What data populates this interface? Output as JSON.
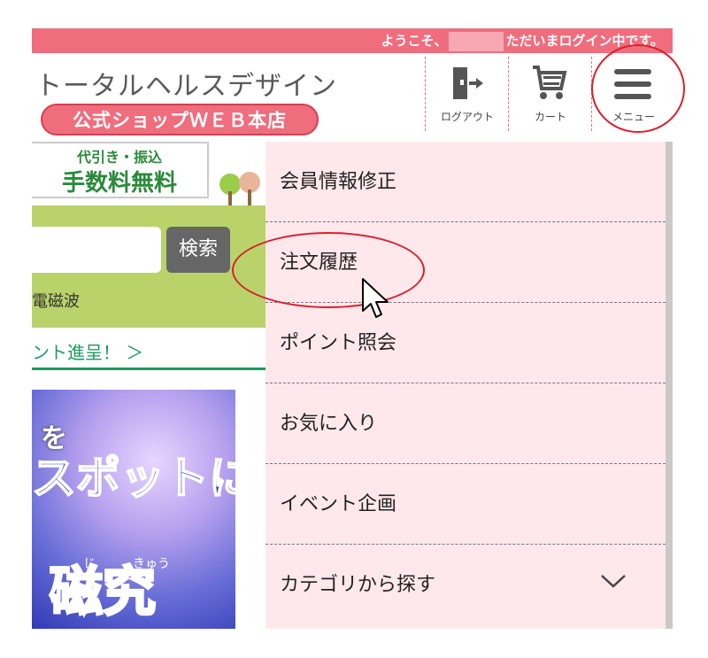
{
  "header": {
    "welcome_prefix": "ようこそ、",
    "welcome_suffix": "ただいまログイン中です。",
    "brand_name": "トータルヘルスデザイン",
    "shop_badge": "公式ショップＷＥＢ本店",
    "logout_label": "ログアウト",
    "cart_label": "カート",
    "menu_label": "メニュー"
  },
  "background_page": {
    "fee_small": "代引き・振込",
    "fee_big": "手数料無料",
    "search_button": "検索",
    "emf_text": "電磁波",
    "campaign_link": "ント進呈！ ＞",
    "banner_line1": "を",
    "banner_line2": "スポットに!",
    "banner_line3": "磁究",
    "banner_ruby": "じ　　　きゅう"
  },
  "menu": {
    "items": [
      {
        "label": "会員情報修正"
      },
      {
        "label": "注文履歴"
      },
      {
        "label": "ポイント照会"
      },
      {
        "label": "お気に入り"
      },
      {
        "label": "イベント企画"
      },
      {
        "label": "カテゴリから探す"
      }
    ]
  },
  "colors": {
    "accent_pink": "#ef6d7d",
    "menu_bg": "#ffe8ec",
    "annotation_red": "#d8202e",
    "green": "#1a9a62"
  }
}
